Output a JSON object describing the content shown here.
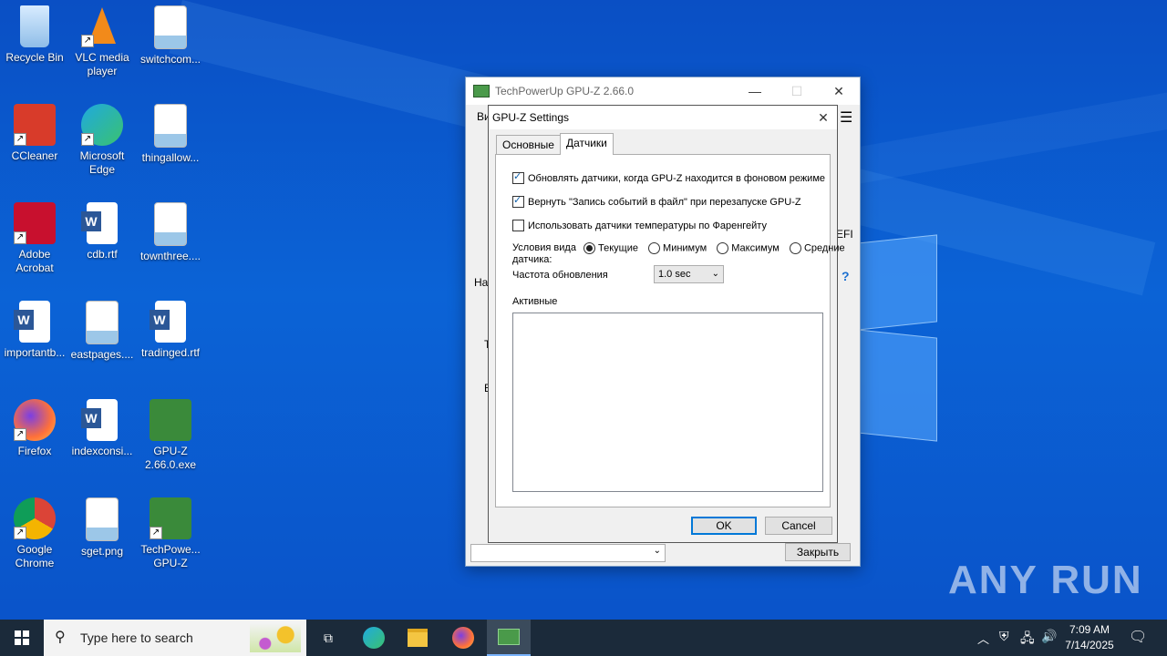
{
  "desktop": {
    "icons": [
      {
        "label": "Recycle Bin",
        "icon": "recycle-bin-icon",
        "color": "#7fb2e8"
      },
      {
        "label": "VLC media player",
        "icon": "vlc-icon",
        "color": "#f28a1a"
      },
      {
        "label": "switchcom...",
        "icon": "image-file-icon",
        "color": "#ffffff"
      },
      {
        "label": "CCleaner",
        "icon": "ccleaner-icon",
        "color": "#d83b2a"
      },
      {
        "label": "Microsoft Edge",
        "icon": "edge-icon",
        "color": "#1fa9e0"
      },
      {
        "label": "thingallow...",
        "icon": "image-file-icon",
        "color": "#ffffff"
      },
      {
        "label": "Adobe Acrobat",
        "icon": "acrobat-icon",
        "color": "#c8102e"
      },
      {
        "label": "cdb.rtf",
        "icon": "word-file-icon",
        "color": "#2b5797"
      },
      {
        "label": "townthree....",
        "icon": "image-file-icon",
        "color": "#ffffff"
      },
      {
        "label": "importantb...",
        "icon": "word-file-icon",
        "color": "#2b5797"
      },
      {
        "label": "eastpages....",
        "icon": "image-file-icon",
        "color": "#ffffff"
      },
      {
        "label": "tradinged.rtf",
        "icon": "word-file-icon",
        "color": "#2b5797"
      },
      {
        "label": "Firefox",
        "icon": "firefox-icon",
        "color": "#ff7139"
      },
      {
        "label": "indexconsi...",
        "icon": "word-file-icon",
        "color": "#2b5797"
      },
      {
        "label": "GPU-Z 2.66.0.exe",
        "icon": "gpuz-icon",
        "color": "#3a8a3a"
      },
      {
        "label": "Google Chrome",
        "icon": "chrome-icon",
        "color": "#db4437"
      },
      {
        "label": "sget.png",
        "icon": "image-file-icon",
        "color": "#ffffff"
      },
      {
        "label": "TechPowe... GPU-Z",
        "icon": "gpuz-icon",
        "color": "#3a8a3a"
      }
    ],
    "watermark": "ANY RUN"
  },
  "gpuz_window": {
    "title": "TechPowerUp GPU-Z 2.66.0",
    "tab_partial": "Ви",
    "side_partial_left": [
      "На",
      "Т",
      "Е"
    ],
    "side_partial_right": "EFI",
    "help_glyph": "?",
    "close_button": "Закрыть"
  },
  "settings_dialog": {
    "title": "GPU-Z Settings",
    "tabs": [
      "Основные",
      "Датчики"
    ],
    "active_tab": "Датчики",
    "options": [
      {
        "label": "Обновлять датчики, когда GPU-Z находится в фоновом режиме",
        "checked": true
      },
      {
        "label": "Вернуть \"Запись событий в файл\" при перезапуске GPU-Z",
        "checked": true
      },
      {
        "label": "Использовать датчики температуры по Фаренгейту",
        "checked": false
      }
    ],
    "view_label": "Условия вида датчика:",
    "view_options": [
      "Текущие",
      "Минимум",
      "Максимум",
      "Средние"
    ],
    "view_selected": "Текущие",
    "refresh_label": "Частота обновления",
    "refresh_value": "1.0 sec",
    "active_label": "Активные",
    "ok": "OK",
    "cancel": "Cancel"
  },
  "taskbar": {
    "search_placeholder": "Type here to search",
    "time": "7:09 AM",
    "date": "7/14/2025"
  }
}
